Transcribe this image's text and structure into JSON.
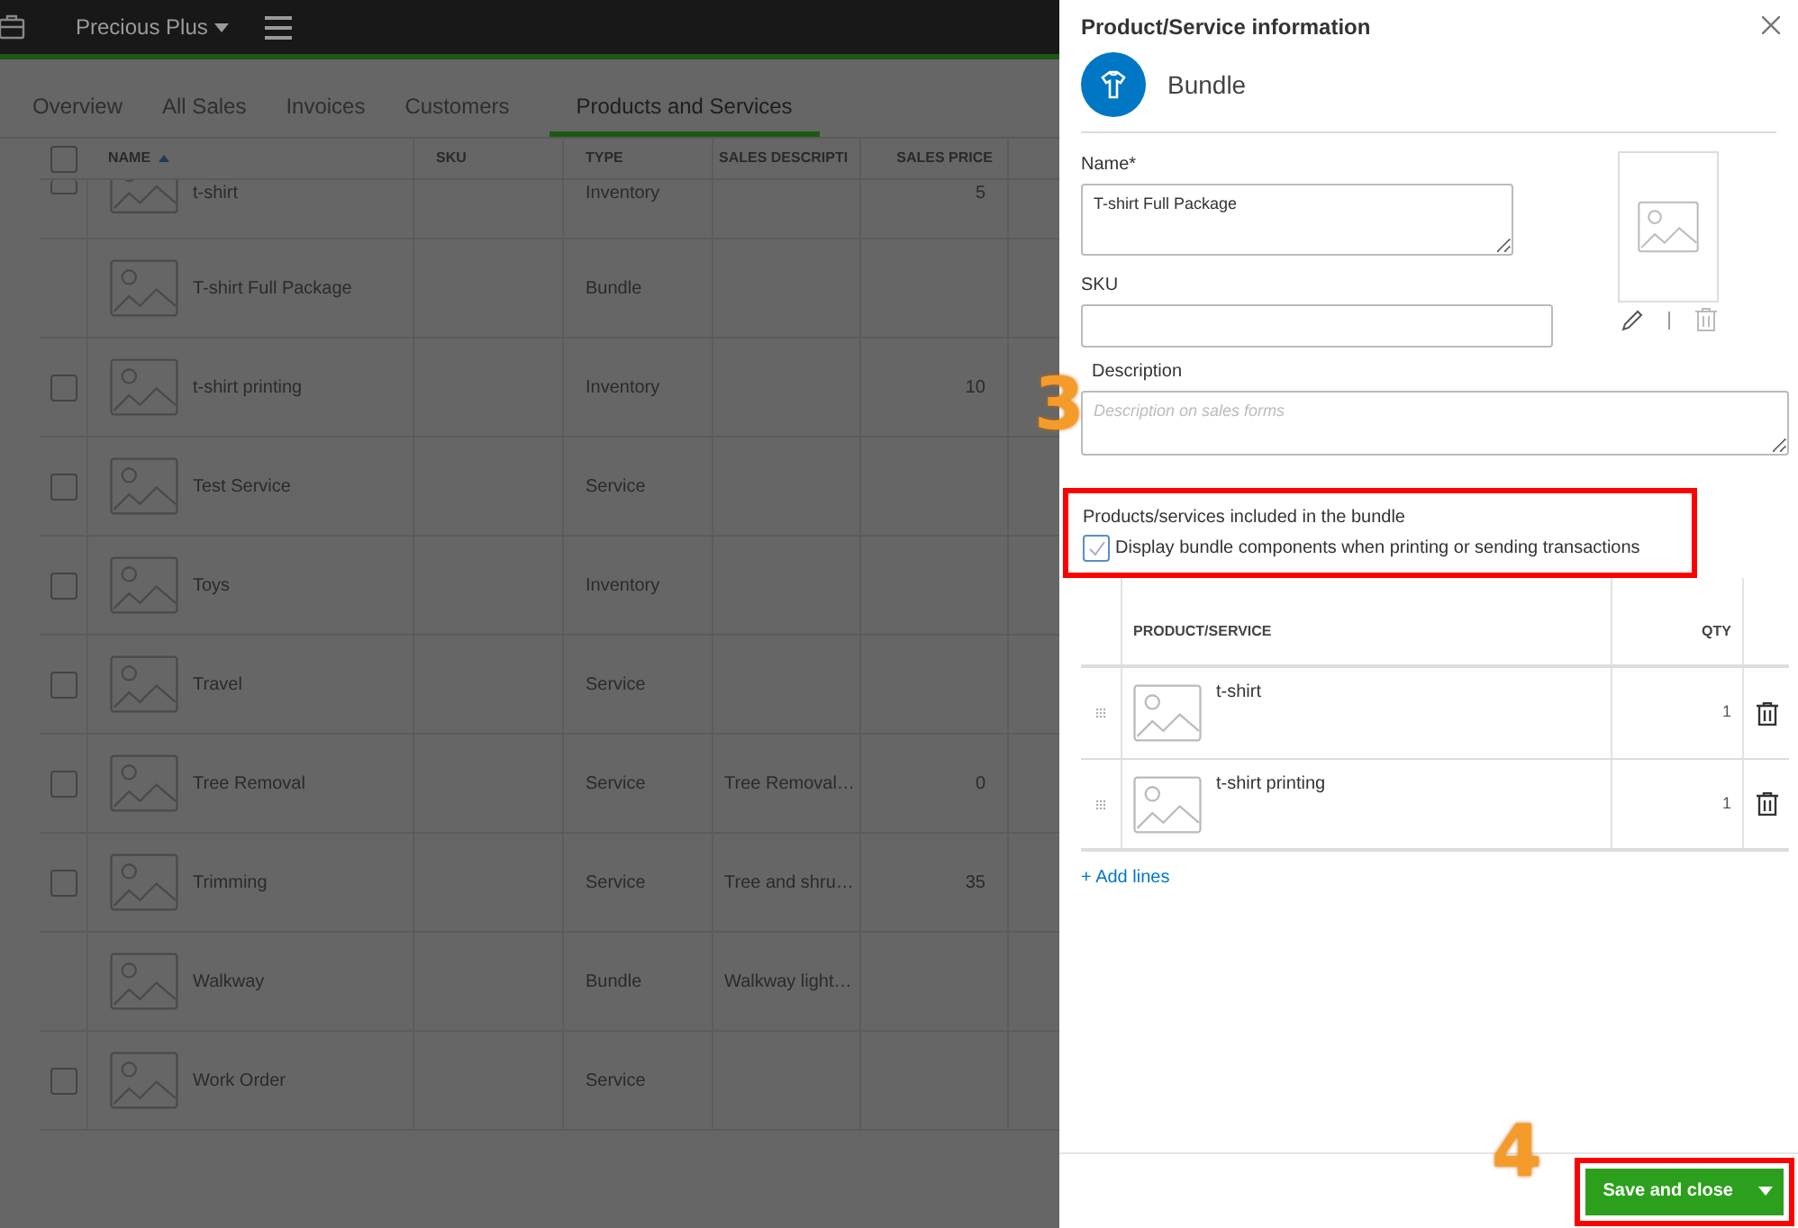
{
  "top_bar": {
    "company": "Precious Plus"
  },
  "tabs": [
    {
      "label": "Overview",
      "selected": false
    },
    {
      "label": "All Sales",
      "selected": false
    },
    {
      "label": "Invoices",
      "selected": false
    },
    {
      "label": "Customers",
      "selected": false
    },
    {
      "label": "Products and Services",
      "selected": true
    }
  ],
  "table": {
    "all_checked": false,
    "columns": [
      "NAME",
      "SKU",
      "TYPE",
      "SALES DESCRIPTI",
      "SALES PRICE"
    ],
    "rows": [
      {
        "name": "t-shirt",
        "type": "Inventory",
        "price": "5",
        "checked": false
      },
      {
        "name": "T-shirt Full Package",
        "type": "Bundle"
      },
      {
        "name": "t-shirt printing",
        "type": "Inventory",
        "price": "10",
        "checked": false
      },
      {
        "name": "Test Service",
        "type": "Service",
        "checked": false
      },
      {
        "name": "Toys",
        "type": "Inventory",
        "checked": false
      },
      {
        "name": "Travel",
        "type": "Service",
        "checked": false
      },
      {
        "name": "Tree Removal",
        "type": "Service",
        "description": "Tree Removal…",
        "price": "0",
        "checked": false
      },
      {
        "name": "Trimming",
        "type": "Service",
        "description": "Tree and shru…",
        "price": "35",
        "checked": false
      },
      {
        "name": "Walkway",
        "type": "Bundle",
        "description": "Walkway light…"
      },
      {
        "name": "Work Order",
        "type": "Service",
        "checked": false
      }
    ]
  },
  "panel": {
    "title": "Product/Service information",
    "item_type": "Bundle",
    "name_field": {
      "label": "Name*",
      "value": "T-shirt Full Package"
    },
    "sku_field": {
      "label": "SKU"
    },
    "description_field": {
      "label": "Description",
      "placeholder": "Description on sales forms"
    },
    "bundle_section": {
      "title": "Products/services included in the bundle",
      "display_components": {
        "label": "Display bundle components when printing or sending transactions",
        "checked": true
      }
    },
    "components": {
      "columns": [
        "PRODUCT/SERVICE",
        "QTY"
      ],
      "rows": [
        {
          "name": "t-shirt",
          "qty": "1"
        },
        {
          "name": "t-shirt printing",
          "qty": "1"
        }
      ]
    },
    "add_lines": "+ Add lines",
    "save_button": "Save and close"
  },
  "annotations": [
    {
      "label": "3"
    },
    {
      "label": "4"
    }
  ]
}
